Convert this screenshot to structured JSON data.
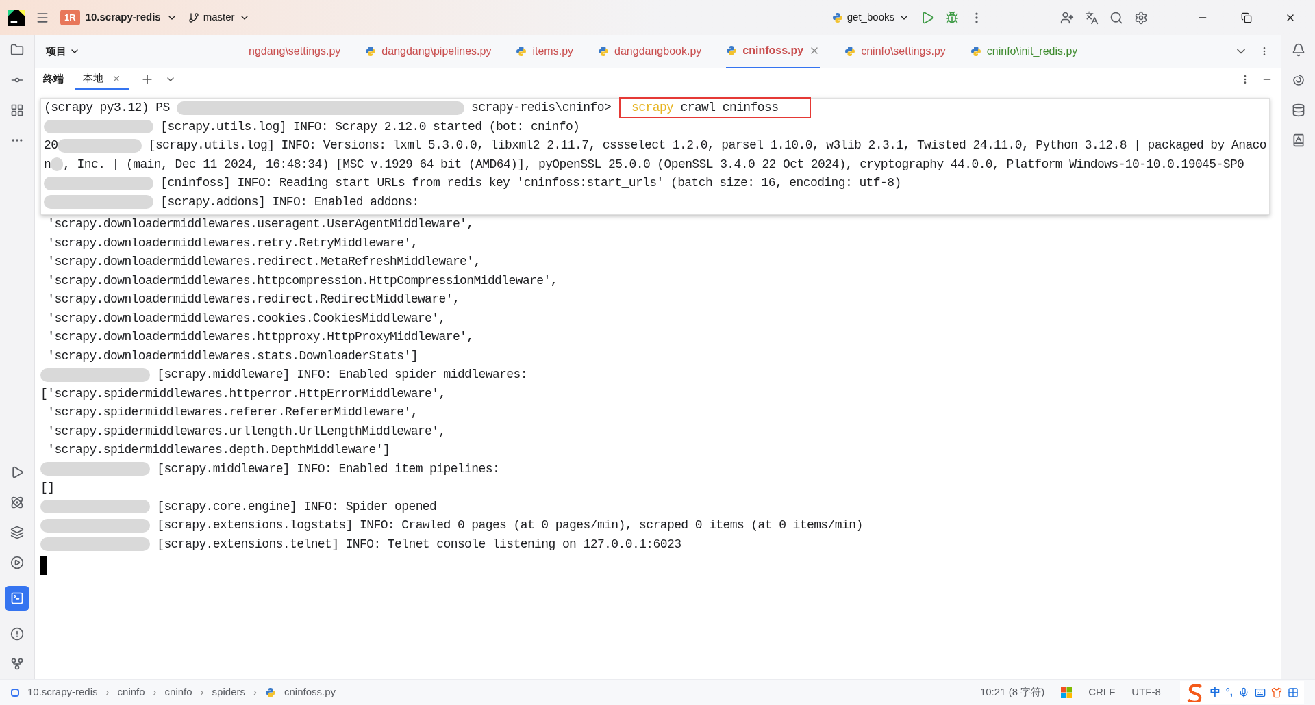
{
  "title_bar": {
    "project_badge": "1R",
    "project": "10.scrapy-redis",
    "branch": "master",
    "run_config": "get_books"
  },
  "project_panel": {
    "label": "项目"
  },
  "editor_tabs": [
    {
      "label": "ngdang\\settings.py",
      "selected": false,
      "color": "#c94f4f"
    },
    {
      "label": "dangdang\\pipelines.py",
      "selected": false,
      "color": "#c94f4f"
    },
    {
      "label": "items.py",
      "selected": false,
      "color": "#c94f4f"
    },
    {
      "label": "dangdangbook.py",
      "selected": false,
      "color": "#c94f4f"
    },
    {
      "label": "cninfoss.py",
      "selected": true,
      "color": "#c94f4f"
    },
    {
      "label": "cninfo\\settings.py",
      "selected": false,
      "color": "#c94f4f"
    },
    {
      "label": "cninfo\\init_redis.py",
      "selected": false,
      "color": "#3f8b2f"
    }
  ],
  "terminal": {
    "label": "终端",
    "tabs": [
      {
        "label": "本地",
        "selected": true
      }
    ],
    "lines": [
      {
        "overlay": true,
        "segments": [
          {
            "kind": "text",
            "text": "(scrapy_py3.12) PS "
          },
          {
            "kind": "redacted_long"
          },
          {
            "kind": "text",
            "text": " scrapy-redis\\cninfo>"
          },
          {
            "kind": "command",
            "program": "scrapy",
            "text": "crawl cninfoss"
          }
        ]
      },
      {
        "overlay": true,
        "segments": [
          {
            "kind": "redacted"
          },
          {
            "kind": "text",
            "text": " [scrapy.utils.log] INFO: Scrapy 2.12.0 started (bot: cninfo)"
          }
        ]
      },
      {
        "overlay": true,
        "segments": [
          {
            "kind": "text",
            "text": "20"
          },
          {
            "kind": "redacted"
          },
          {
            "kind": "text",
            "text": " [scrapy.utils.log] INFO: Versions: lxml 5.3.0.0, libxml2 2.11.7, cssselect 1.2.0, parsel 1.10.0, w3lib 2.3.1, Twisted 24.11.0, Python 3.12.8 | packaged by Anaco"
          }
        ]
      },
      {
        "overlay": true,
        "segments": [
          {
            "kind": "text",
            "text": "n"
          },
          {
            "kind": "redacted_short"
          },
          {
            "kind": "text",
            "text": ", Inc. | (main, Dec 11 2024, 16:48:34) [MSC v.1929 64 bit (AMD64)], pyOpenSSL 25.0.0 (OpenSSL 3.4.0 22 Oct 2024), cryptography 44.0.0, Platform Windows-10-10.0.19045-SP0"
          }
        ]
      },
      {
        "overlay": true,
        "segments": [
          {
            "kind": "redacted"
          },
          {
            "kind": "text",
            "text": " [cninfoss] INFO: Reading start URLs from redis key 'cninfoss:start_urls' (batch size: 16, encoding: utf-8)"
          }
        ]
      },
      {
        "overlay": true,
        "segments": [
          {
            "kind": "redacted"
          },
          {
            "kind": "text",
            "text": " [scrapy.addons] INFO: Enabled addons:"
          }
        ]
      },
      {
        "overlay": false,
        "segments": [
          {
            "kind": "text",
            "text": " 'scrapy.downloadermiddlewares.useragent.UserAgentMiddleware',"
          }
        ]
      },
      {
        "overlay": false,
        "segments": [
          {
            "kind": "text",
            "text": " 'scrapy.downloadermiddlewares.retry.RetryMiddleware',"
          }
        ]
      },
      {
        "overlay": false,
        "segments": [
          {
            "kind": "text",
            "text": " 'scrapy.downloadermiddlewares.redirect.MetaRefreshMiddleware',"
          }
        ]
      },
      {
        "overlay": false,
        "segments": [
          {
            "kind": "text",
            "text": " 'scrapy.downloadermiddlewares.httpcompression.HttpCompressionMiddleware',"
          }
        ]
      },
      {
        "overlay": false,
        "segments": [
          {
            "kind": "text",
            "text": " 'scrapy.downloadermiddlewares.redirect.RedirectMiddleware',"
          }
        ]
      },
      {
        "overlay": false,
        "segments": [
          {
            "kind": "text",
            "text": " 'scrapy.downloadermiddlewares.cookies.CookiesMiddleware',"
          }
        ]
      },
      {
        "overlay": false,
        "segments": [
          {
            "kind": "text",
            "text": " 'scrapy.downloadermiddlewares.httpproxy.HttpProxyMiddleware',"
          }
        ]
      },
      {
        "overlay": false,
        "segments": [
          {
            "kind": "text",
            "text": " 'scrapy.downloadermiddlewares.stats.DownloaderStats']"
          }
        ]
      },
      {
        "overlay": false,
        "segments": [
          {
            "kind": "redacted"
          },
          {
            "kind": "text",
            "text": " [scrapy.middleware] INFO: Enabled spider middlewares:"
          }
        ]
      },
      {
        "overlay": false,
        "segments": [
          {
            "kind": "text",
            "text": "['scrapy.spidermiddlewares.httperror.HttpErrorMiddleware',"
          }
        ]
      },
      {
        "overlay": false,
        "segments": [
          {
            "kind": "text",
            "text": " 'scrapy.spidermiddlewares.referer.RefererMiddleware',"
          }
        ]
      },
      {
        "overlay": false,
        "segments": [
          {
            "kind": "text",
            "text": " 'scrapy.spidermiddlewares.urllength.UrlLengthMiddleware',"
          }
        ]
      },
      {
        "overlay": false,
        "segments": [
          {
            "kind": "text",
            "text": " 'scrapy.spidermiddlewares.depth.DepthMiddleware']"
          }
        ]
      },
      {
        "overlay": false,
        "segments": [
          {
            "kind": "redacted"
          },
          {
            "kind": "text",
            "text": " [scrapy.middleware] INFO: Enabled item pipelines:"
          }
        ]
      },
      {
        "overlay": false,
        "segments": [
          {
            "kind": "text",
            "text": "[]"
          }
        ]
      },
      {
        "overlay": false,
        "segments": [
          {
            "kind": "redacted"
          },
          {
            "kind": "text",
            "text": " [scrapy.core.engine] INFO: Spider opened"
          }
        ]
      },
      {
        "overlay": false,
        "segments": [
          {
            "kind": "redacted"
          },
          {
            "kind": "text",
            "text": " [scrapy.extensions.logstats] INFO: Crawled 0 pages (at 0 pages/min), scraped 0 items (at 0 items/min)"
          }
        ]
      },
      {
        "overlay": false,
        "segments": [
          {
            "kind": "redacted"
          },
          {
            "kind": "text",
            "text": " [scrapy.extensions.telnet] INFO: Telnet console listening on 127.0.0.1:6023"
          }
        ]
      }
    ]
  },
  "status_bar": {
    "breadcrumbs": [
      "10.scrapy-redis",
      "cninfo",
      "cninfo",
      "spiders",
      "cninfoss.py"
    ],
    "separator": "›",
    "position": "10:21 (8 字符)",
    "line_ending": "CRLF",
    "encoding": "UTF-8",
    "ime_mode": "中",
    "ime_punct": "°,"
  }
}
